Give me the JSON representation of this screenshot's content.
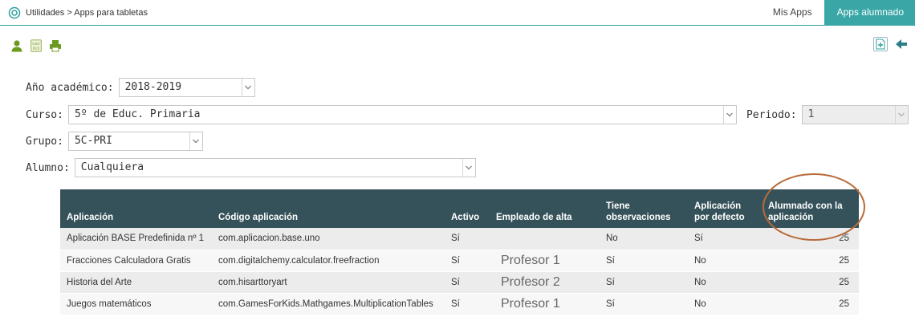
{
  "breadcrumb": {
    "text": "Utilidades > Apps para tabletas",
    "icon": "location-pin-icon"
  },
  "tabs": [
    {
      "label": "Mis Apps",
      "active": false
    },
    {
      "label": "Apps alumnado",
      "active": true
    }
  ],
  "colors": {
    "accent": "#3aa7a6",
    "table_header": "#35525a",
    "icons_green": "#6a9a1f",
    "highlight_ring": "#b86a3a"
  },
  "toolbar": {
    "left_icons": [
      "person-icon",
      "csv-xls-export-icon",
      "print-icon"
    ],
    "right_icons": [
      "add-document-icon",
      "back-arrow-icon"
    ]
  },
  "form": {
    "anio": {
      "label": "Año académico:",
      "value": "2018-2019"
    },
    "curso": {
      "label": "Curso:",
      "value": "5º de Educ. Primaria"
    },
    "periodo": {
      "label": "Periodo:",
      "value": "1"
    },
    "grupo": {
      "label": "Grupo:",
      "value": "5C-PRI"
    },
    "alumno": {
      "label": "Alumno:",
      "value": "Cualquiera"
    }
  },
  "table": {
    "headers": {
      "aplicacion": "Aplicación",
      "codigo": "Código aplicación",
      "activo": "Activo",
      "empleado": "Empleado de alta",
      "observaciones": "Tiene observaciones",
      "defecto": "Aplicación por defecto",
      "alumnado": "Alumnado con la aplicación"
    },
    "rows": [
      {
        "aplicacion": "Aplicación BASE Predefinida nº 1",
        "codigo": "com.aplicacion.base.uno",
        "activo": "Sí",
        "empleado": "",
        "observaciones": "No",
        "defecto": "Sí",
        "alumnado": "25"
      },
      {
        "aplicacion": "Fracciones Calculadora Gratis",
        "codigo": "com.digitalchemy.calculator.freefraction",
        "activo": "Sí",
        "empleado": "Profesor 1",
        "observaciones": "Sí",
        "defecto": "No",
        "alumnado": "25"
      },
      {
        "aplicacion": "Historia del Arte",
        "codigo": "com.hisarttoryart",
        "activo": "Sí",
        "empleado": "Profesor 2",
        "observaciones": "Sí",
        "defecto": "No",
        "alumnado": "25"
      },
      {
        "aplicacion": "Juegos matemáticos",
        "codigo": "com.GamesForKids.Mathgames.MultiplicationTables",
        "activo": "Sí",
        "empleado": "Profesor 1",
        "observaciones": "Sí",
        "defecto": "No",
        "alumnado": "25"
      }
    ]
  }
}
